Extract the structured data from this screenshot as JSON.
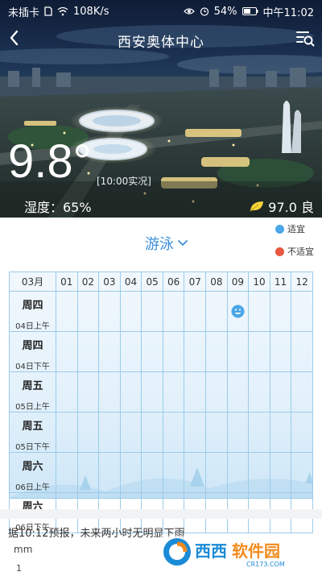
{
  "statusbar": {
    "carrier": "未插卡",
    "speed": "108K/s",
    "battery": "54%",
    "time": "中午11:02"
  },
  "header": {
    "title": "西安奥体中心"
  },
  "weather": {
    "temperature": "9.8°",
    "observed": "[10:00实况]",
    "humidity": "湿度：65%",
    "aqi": "97.0 良"
  },
  "activity": {
    "selected": "游泳"
  },
  "legend": {
    "suitable": "适宜",
    "unsuitable": "不适宜",
    "suitable_color": "#4aa6e8",
    "unsuitable_color": "#e8573f"
  },
  "grid": {
    "month": "03月",
    "hours": [
      "01",
      "02",
      "03",
      "04",
      "05",
      "06",
      "07",
      "08",
      "09",
      "10",
      "11",
      "12"
    ],
    "rows": [
      {
        "day": "周四",
        "sub": "04日上午"
      },
      {
        "day": "周四",
        "sub": "04日下午"
      },
      {
        "day": "周五",
        "sub": "05日上午"
      },
      {
        "day": "周五",
        "sub": "05日下午"
      },
      {
        "day": "周六",
        "sub": "06日上午"
      },
      {
        "day": "周六",
        "sub": "06日下午"
      }
    ],
    "marks": [
      {
        "row": 0,
        "hour": "09",
        "status": "suitable"
      }
    ]
  },
  "forecast": {
    "text": "据10:12预报，未来两小时无明显下雨",
    "unit": "mm",
    "tick": "1"
  },
  "watermark": {
    "brand": "西西软件园",
    "domain": "CR173.COM"
  }
}
